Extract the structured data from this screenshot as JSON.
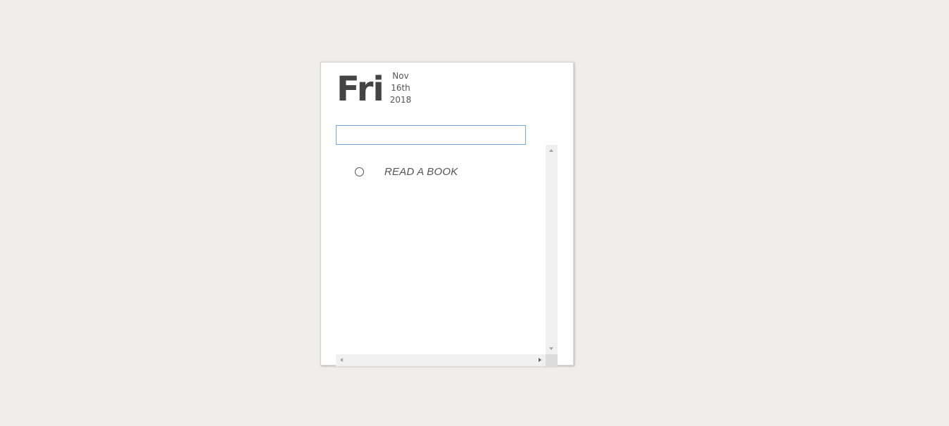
{
  "header": {
    "day": "Fri",
    "month": "Nov",
    "day_of_month": "16th",
    "year": "2018"
  },
  "input": {
    "value": "",
    "placeholder": ""
  },
  "todos": [
    {
      "text": "READ A BOOK",
      "done": false,
      "icon": "circle-outline-icon"
    }
  ],
  "scrollbars": {
    "up_icon": "scroll-up-arrow-icon",
    "down_icon": "scroll-down-arrow-icon",
    "left_icon": "scroll-left-arrow-icon",
    "right_icon": "scroll-right-arrow-icon"
  },
  "colors": {
    "background": "#efeeec",
    "card": "#ffffff",
    "text": "#444444",
    "input_focus_border": "#7aa7d8"
  }
}
